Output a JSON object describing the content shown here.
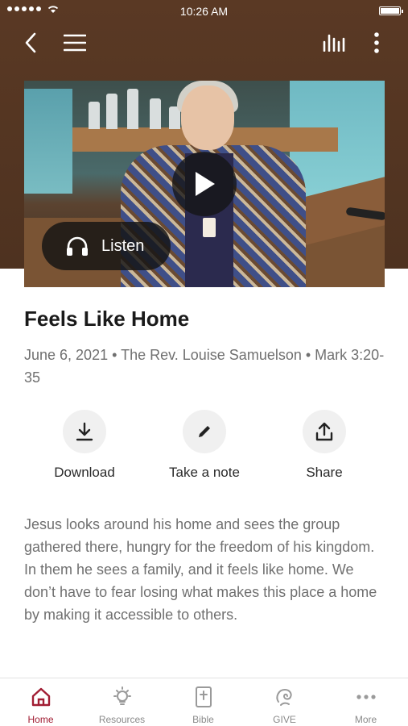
{
  "status_bar": {
    "time": "10:26 AM"
  },
  "nav": {
    "back_icon": "chevron-left-icon",
    "menu_icon": "hamburger-menu-icon",
    "audio_icon": "audio-bars-icon",
    "more_icon": "vertical-dots-icon"
  },
  "media": {
    "play_icon": "play-icon",
    "listen_label": "Listen",
    "listen_icon": "headphones-icon"
  },
  "sermon": {
    "title": "Feels Like Home",
    "meta": "June 6, 2021 • The Rev. Louise Samuelson • Mark 3:20-35",
    "description": "Jesus looks around his home and sees the group gathered there, hungry for the freedom of his kingdom. In them he sees a family, and it feels like home. We don’t have to fear losing what makes this place a home by making it accessible to others."
  },
  "actions": [
    {
      "label": "Download",
      "icon": "download-icon"
    },
    {
      "label": "Take a note",
      "icon": "pencil-icon"
    },
    {
      "label": "Share",
      "icon": "share-icon"
    }
  ],
  "tabs": [
    {
      "label": "Home",
      "icon": "home-icon",
      "active": true
    },
    {
      "label": "Resources",
      "icon": "lightbulb-icon",
      "active": false
    },
    {
      "label": "Bible",
      "icon": "bible-icon",
      "active": false
    },
    {
      "label": "GIVE",
      "icon": "give-icon",
      "active": false
    },
    {
      "label": "More",
      "icon": "dots-icon",
      "active": false
    }
  ],
  "colors": {
    "header_brown": "#5a3924",
    "accent_red": "#a11d33",
    "text_dark": "#1a1a1a",
    "text_muted": "#707070"
  }
}
